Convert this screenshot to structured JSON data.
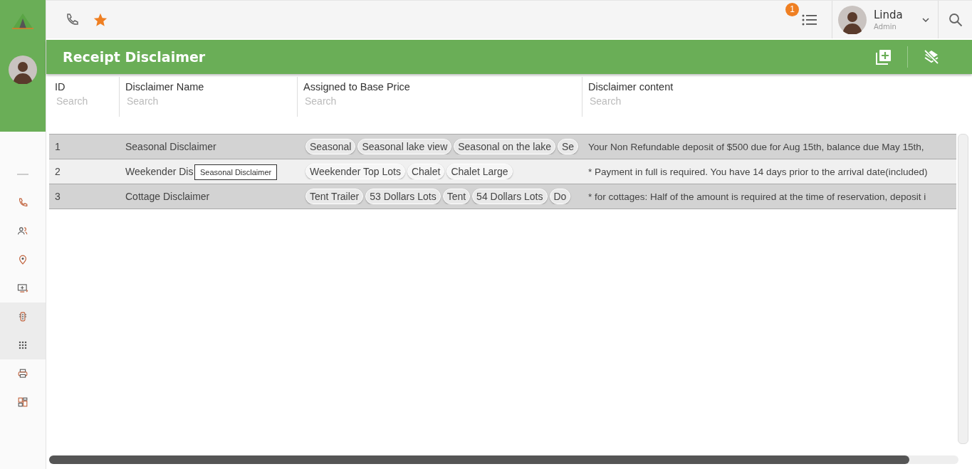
{
  "topbar": {
    "notification_count": "1",
    "user": {
      "name": "Linda",
      "role": "Admin"
    }
  },
  "sidebar": {
    "items": [
      {
        "selected": false
      },
      {
        "selected": false
      },
      {
        "selected": false
      },
      {
        "selected": false
      },
      {
        "selected": true
      },
      {
        "selected": true
      },
      {
        "selected": false
      },
      {
        "selected": false
      }
    ]
  },
  "page_title": "Receipt Disclaimer",
  "table": {
    "columns": [
      {
        "label": "ID",
        "placeholder": "Search"
      },
      {
        "label": "Disclaimer Name",
        "placeholder": "Search"
      },
      {
        "label": "Assigned to Base Price",
        "placeholder": "Search"
      },
      {
        "label": "Disclaimer content",
        "placeholder": "Search"
      }
    ],
    "rows": [
      {
        "id": "1",
        "name": "Seasonal Disclaimer",
        "selected": true,
        "tags": [
          "Seasonal",
          "Seasonal lake view",
          "Seasonal on the lake",
          "Se"
        ],
        "content": "Your Non Refundable deposit of $500 due for Aug 15th, balance due May 15th,"
      },
      {
        "id": "2",
        "name": "Weekender Dis",
        "selected": false,
        "tags": [
          "Weekender Top Lots",
          "Chalet",
          "Chalet Large"
        ],
        "content": "* Payment in full is required. You have 14 days prior to the arrival date(included)"
      },
      {
        "id": "3",
        "name": "Cottage Disclaimer",
        "selected": true,
        "tags": [
          "Tent Trailer",
          "53 Dollars Lots",
          "Tent",
          "54 Dollars Lots",
          "Do"
        ],
        "content": "* for cottages: Half of the amount is required at the time of reservation, deposit i"
      }
    ]
  },
  "tooltip": {
    "text": "Seasonal Disclaimer"
  }
}
